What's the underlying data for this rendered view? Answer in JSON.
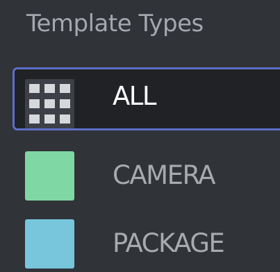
{
  "panel": {
    "title": "Template Types"
  },
  "types": [
    {
      "label": "ALL",
      "icon": "grid-icon",
      "selected": true
    },
    {
      "label": "CAMERA",
      "color": "#7fd8a4",
      "selected": false
    },
    {
      "label": "PACKAGE",
      "color": "#78c6dc",
      "selected": false
    }
  ],
  "colors": {
    "background": "#303338",
    "selected_background": "#202226",
    "selection_border": "#5d6fc9"
  }
}
